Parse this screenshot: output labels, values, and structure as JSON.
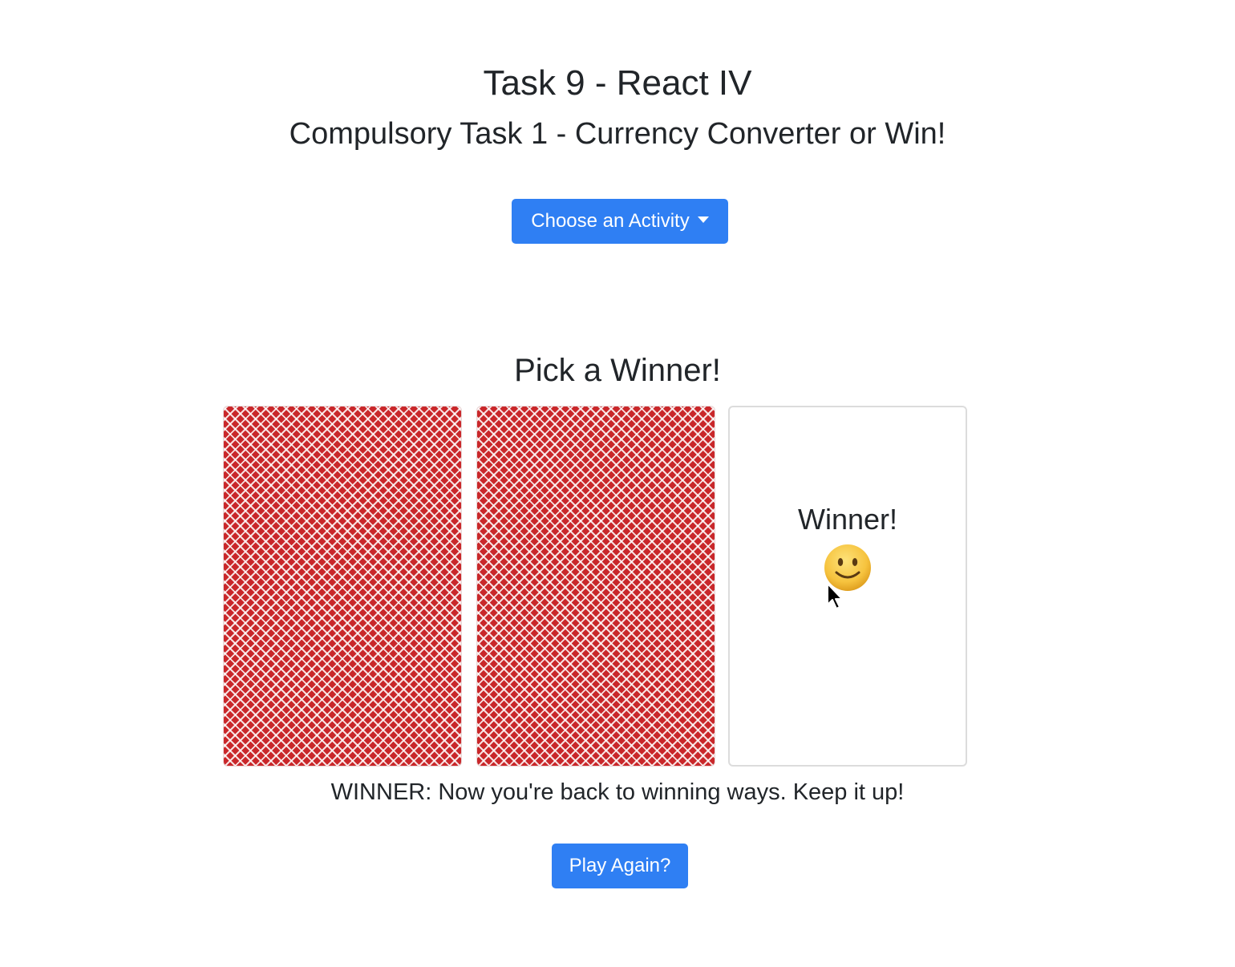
{
  "header": {
    "title": "Task 9 - React IV",
    "subtitle": "Compulsory Task 1 - Currency Converter or Win!"
  },
  "activity_dropdown": {
    "label": "Choose an Activity",
    "icon": "caret-down-icon"
  },
  "game": {
    "title": "Pick a Winner!",
    "cards": [
      {
        "state": "face-down"
      },
      {
        "state": "face-down"
      },
      {
        "state": "revealed",
        "label": "Winner!",
        "icon": "smiley-face-icon"
      }
    ],
    "result_message": "WINNER: Now you're back to winning ways. Keep it up!",
    "play_again_label": "Play Again?"
  },
  "colors": {
    "primary_button": "#2f7ff3",
    "card_back": "#c9272a",
    "text": "#212529"
  }
}
